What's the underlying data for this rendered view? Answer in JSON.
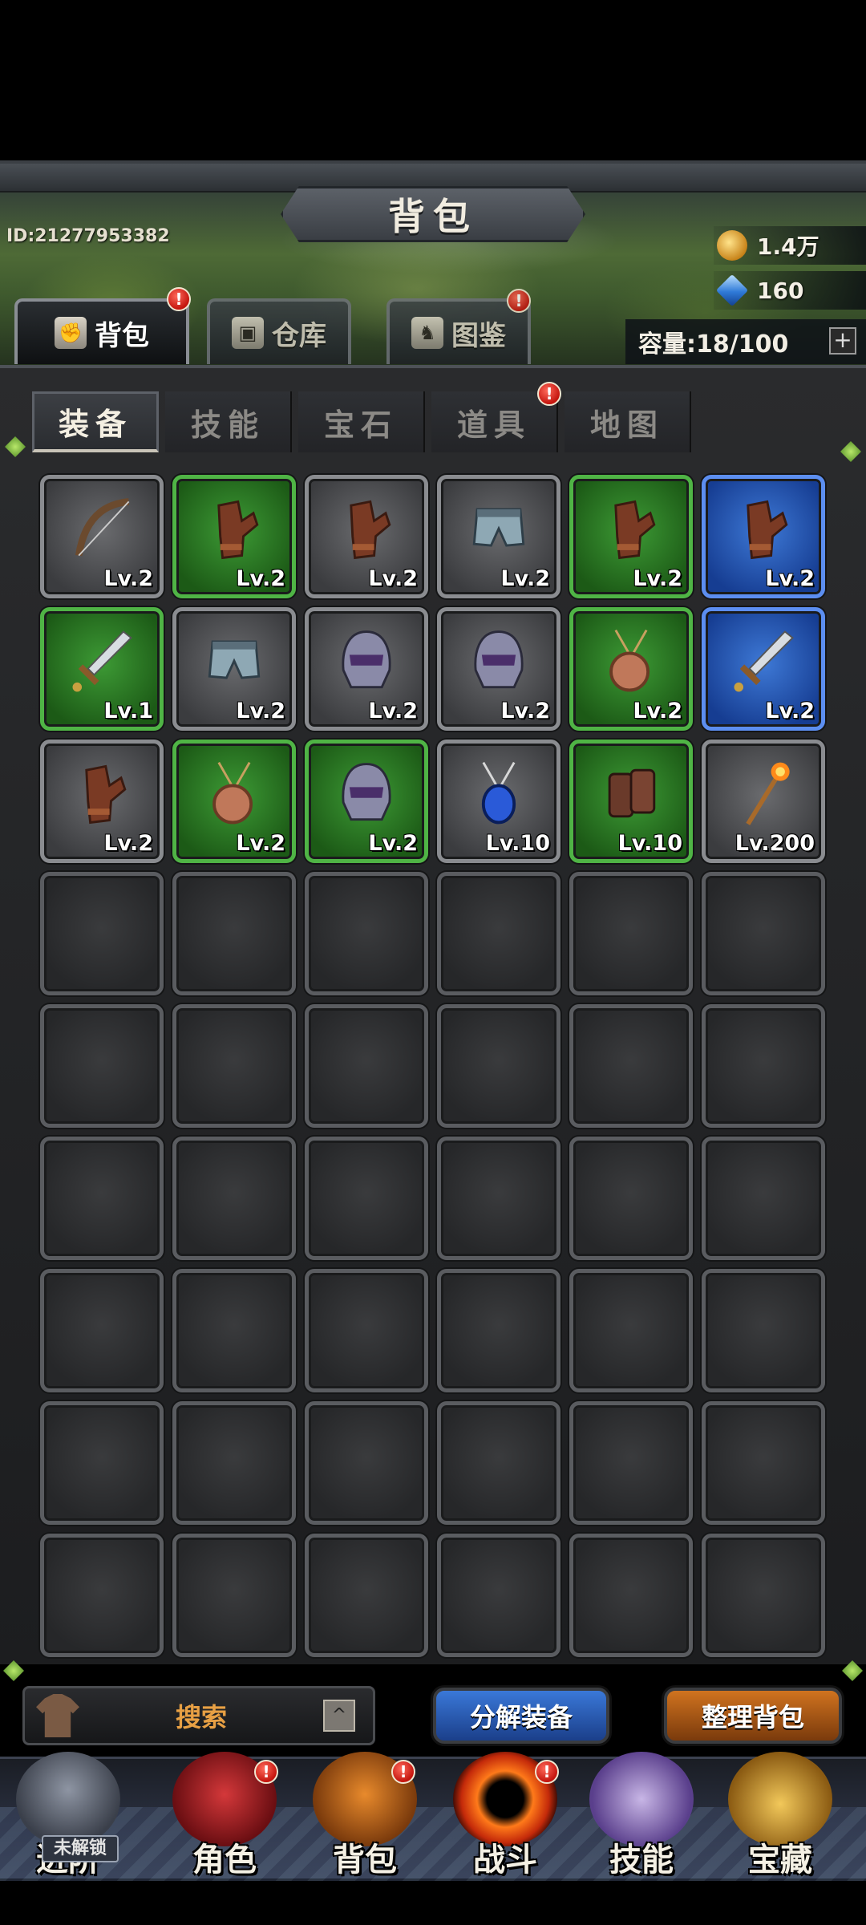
{
  "header": {
    "title": "背包",
    "player_id": "ID:21277953382",
    "gold": "1.4万",
    "gems": "160"
  },
  "top_tabs": [
    {
      "label": "背包",
      "icon": "fist-icon",
      "active": true,
      "badge": "!"
    },
    {
      "label": "仓库",
      "icon": "chest-icon",
      "active": false
    },
    {
      "label": "图鉴",
      "icon": "codex-icon",
      "active": false,
      "badge": "!"
    }
  ],
  "capacity": {
    "label": "容量:18/100",
    "add": "+"
  },
  "sub_tabs": [
    {
      "label": "装备",
      "active": true
    },
    {
      "label": "技能",
      "active": false
    },
    {
      "label": "宝石",
      "active": false
    },
    {
      "label": "道具",
      "active": false,
      "badge": "!"
    },
    {
      "label": "地图",
      "active": false
    }
  ],
  "inventory": {
    "rows": 9,
    "cols": 6,
    "items": [
      {
        "name": "bow",
        "rarity": "gray",
        "level": "Lv.2"
      },
      {
        "name": "gloves",
        "rarity": "green",
        "level": "Lv.2"
      },
      {
        "name": "gloves",
        "rarity": "gray",
        "level": "Lv.2"
      },
      {
        "name": "pants",
        "rarity": "gray",
        "level": "Lv.2"
      },
      {
        "name": "gloves",
        "rarity": "green",
        "level": "Lv.2"
      },
      {
        "name": "gloves",
        "rarity": "blue",
        "level": "Lv.2"
      },
      {
        "name": "sword",
        "rarity": "green",
        "level": "Lv.1"
      },
      {
        "name": "pants",
        "rarity": "gray",
        "level": "Lv.2"
      },
      {
        "name": "helmet",
        "rarity": "gray",
        "level": "Lv.2"
      },
      {
        "name": "helmet",
        "rarity": "gray",
        "level": "Lv.2"
      },
      {
        "name": "amulet",
        "rarity": "green",
        "level": "Lv.2"
      },
      {
        "name": "sword",
        "rarity": "blue",
        "level": "Lv.2"
      },
      {
        "name": "gloves",
        "rarity": "gray",
        "level": "Lv.2"
      },
      {
        "name": "amulet",
        "rarity": "green",
        "level": "Lv.2"
      },
      {
        "name": "helmet",
        "rarity": "green",
        "level": "Lv.2"
      },
      {
        "name": "sapphire-amulet",
        "rarity": "gray",
        "level": "Lv.10"
      },
      {
        "name": "bracers",
        "rarity": "green",
        "level": "Lv.10"
      },
      {
        "name": "fire-staff",
        "rarity": "gray",
        "level": "Lv.200"
      }
    ]
  },
  "controls": {
    "search_label": "搜索",
    "search_toggle": "^",
    "dismantle_label": "分解装备",
    "sort_label": "整理背包"
  },
  "nav": [
    {
      "label": "进阶",
      "locked_tag": "未解锁"
    },
    {
      "label": "角色",
      "badge": "!"
    },
    {
      "label": "背包",
      "badge": "!"
    },
    {
      "label": "战斗",
      "badge": "!"
    },
    {
      "label": "技能"
    },
    {
      "label": "宝藏"
    }
  ],
  "colors": {
    "rarity_green": "#3d9a35",
    "rarity_blue": "#3e79d6",
    "rarity_gray": "#6a6b6e",
    "badge_red": "#c4150e",
    "search_text": "#e8a044"
  }
}
